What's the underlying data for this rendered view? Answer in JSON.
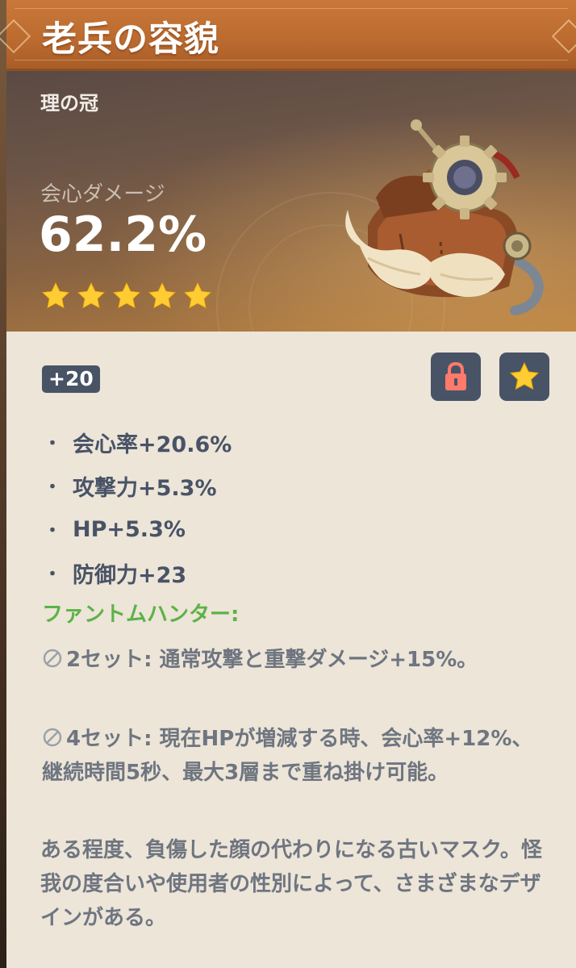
{
  "title": "老兵の容貌",
  "slot": "理の冠",
  "main_stat": {
    "name": "会心ダメージ",
    "value": "62.2%"
  },
  "rarity_stars": 5,
  "level": "+20",
  "icons": {
    "lock": "lock-icon",
    "favorite": "star-icon"
  },
  "colors": {
    "title_bar": "#c9783a",
    "set_name": "#5cb247",
    "badge": "#495366",
    "star": "#ffcc33",
    "lock": "#ff7a6b"
  },
  "substats": [
    "会心率+20.6%",
    "攻撃力+5.3%",
    "HP+5.3%",
    "防御力+23"
  ],
  "set": {
    "name": "ファントムハンター:",
    "bonus2": "2セット: 通常攻撃と重撃ダメージ+15%。",
    "bonus4": "4セット: 現在HPが増減する時、会心率+12%、継続時間5秒、最大3層まで重ね掛け可能。"
  },
  "description": "ある程度、負傷した顔の代わりになる古いマスク。怪我の度合いや使用者の性別によって、さまざまなデザインがある。"
}
